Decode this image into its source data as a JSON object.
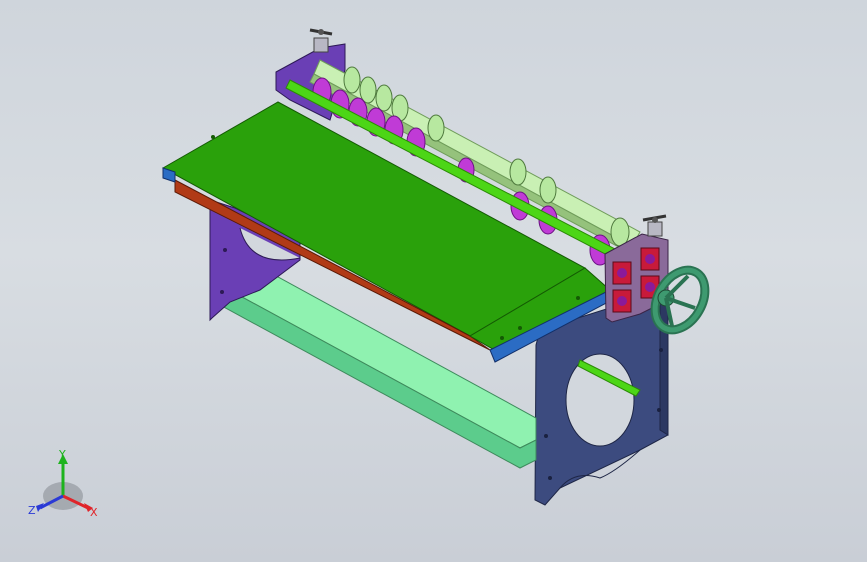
{
  "viewport": {
    "background_top": "#cfd5dc",
    "background_bottom": "#c9ced6"
  },
  "model": {
    "colors": {
      "table_top": "#2aa10b",
      "table_edge": "#1f7a08",
      "table_underside": "#b13a16",
      "table_rail": "#2b6cc4",
      "frame_plate": "#3c4b7f",
      "frame_plate_dark": "#2c3862",
      "left_plate": "#6a3fb5",
      "crossbar": "#8ff2b0",
      "crossbar_dark": "#5ccc8c",
      "shaft": "#c9f0b4",
      "shaft_dark": "#95c27c",
      "rod": "#4cd616",
      "cutter": "#c03bd6",
      "cutter_dark": "#8a1ea8",
      "bearing_block": "#8a6a9a",
      "bearing_red": "#c81a3a",
      "handwheel": "#3e9a70",
      "handwheel_dark": "#2a7352",
      "clamp": "#b8b8c4"
    },
    "parts": [
      "table",
      "frame-right",
      "frame-left",
      "crossbar",
      "top-shaft",
      "cutter-rod",
      "handwheel",
      "bearing-blocks",
      "clamps"
    ]
  },
  "triad": {
    "x_label": "X",
    "y_label": "Y",
    "z_label": "Z",
    "x_color": "#e0242a",
    "y_color": "#1db31d",
    "z_color": "#2a3ad6"
  }
}
